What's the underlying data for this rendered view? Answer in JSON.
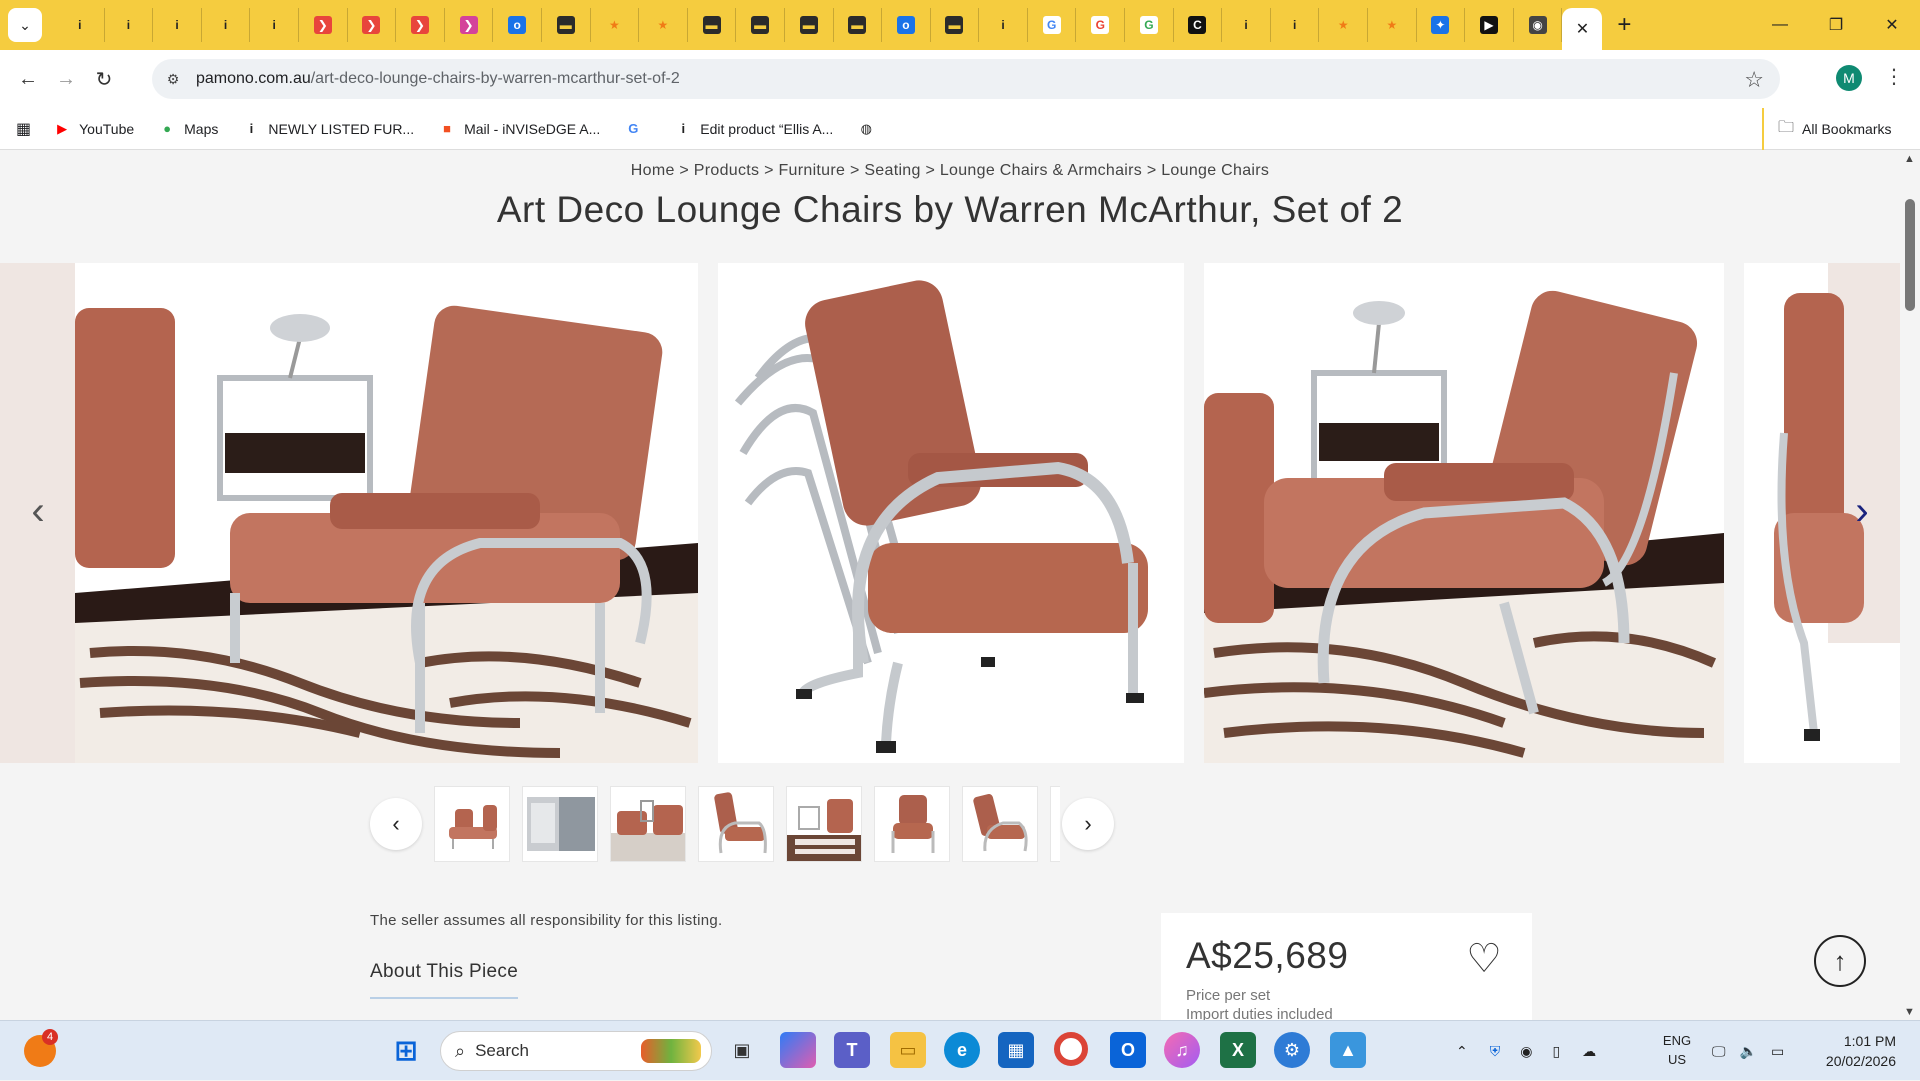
{
  "browser": {
    "active_tab_close": "✕",
    "new_tab": "+",
    "tab_favicons": [
      {
        "icon": "info-icon",
        "glyph": "i",
        "color": "#f5cc3f",
        "fg": "#222"
      },
      {
        "icon": "info-icon",
        "glyph": "i",
        "color": "#f5cc3f",
        "fg": "#222"
      },
      {
        "icon": "info-icon",
        "glyph": "i",
        "color": "#f5cc3f",
        "fg": "#222"
      },
      {
        "icon": "info-icon",
        "glyph": "i",
        "color": "#f5cc3f",
        "fg": "#222"
      },
      {
        "icon": "info-icon",
        "glyph": "i",
        "color": "#f5cc3f",
        "fg": "#222"
      },
      {
        "icon": "bird-icon",
        "glyph": "❯",
        "color": "#e8453c",
        "fg": "#fff"
      },
      {
        "icon": "bird-icon",
        "glyph": "❯",
        "color": "#e8453c",
        "fg": "#fff"
      },
      {
        "icon": "bird-icon",
        "glyph": "❯",
        "color": "#e8453c",
        "fg": "#fff"
      },
      {
        "icon": "bird-icon",
        "glyph": "❯",
        "color": "#d4429b",
        "fg": "#fff"
      },
      {
        "icon": "outlook-icon",
        "glyph": "o",
        "color": "#1a73e8",
        "fg": "#fff"
      },
      {
        "icon": "briefcase-icon",
        "glyph": "▬",
        "color": "#2b2b2b",
        "fg": "#f5cc3f"
      },
      {
        "icon": "star-icon",
        "glyph": "★",
        "color": "#f5cc3f",
        "fg": "#f07b16"
      },
      {
        "icon": "star-icon",
        "glyph": "★",
        "color": "#f5cc3f",
        "fg": "#f07b16"
      },
      {
        "icon": "briefcase-icon",
        "glyph": "▬",
        "color": "#2b2b2b",
        "fg": "#f5cc3f"
      },
      {
        "icon": "briefcase-icon",
        "glyph": "▬",
        "color": "#2b2b2b",
        "fg": "#f5cc3f"
      },
      {
        "icon": "briefcase-icon",
        "glyph": "▬",
        "color": "#2b2b2b",
        "fg": "#f5cc3f"
      },
      {
        "icon": "briefcase-icon",
        "glyph": "▬",
        "color": "#2b2b2b",
        "fg": "#f5cc3f"
      },
      {
        "icon": "outlook-icon",
        "glyph": "o",
        "color": "#1a73e8",
        "fg": "#fff"
      },
      {
        "icon": "briefcase-icon",
        "glyph": "▬",
        "color": "#2b2b2b",
        "fg": "#f5cc3f"
      },
      {
        "icon": "info-icon",
        "glyph": "i",
        "color": "#f5cc3f",
        "fg": "#222"
      },
      {
        "icon": "google-icon",
        "glyph": "G",
        "color": "#fff",
        "fg": "#4285f4"
      },
      {
        "icon": "google-icon",
        "glyph": "G",
        "color": "#fff",
        "fg": "#ea4335"
      },
      {
        "icon": "google-icon",
        "glyph": "G",
        "color": "#fff",
        "fg": "#34a853"
      },
      {
        "icon": "c-logo-icon",
        "glyph": "C",
        "color": "#111",
        "fg": "#fff"
      },
      {
        "icon": "info-icon",
        "glyph": "i",
        "color": "#f5cc3f",
        "fg": "#222"
      },
      {
        "icon": "info-icon",
        "glyph": "i",
        "color": "#f5cc3f",
        "fg": "#222"
      },
      {
        "icon": "star-icon",
        "glyph": "★",
        "color": "#f5cc3f",
        "fg": "#f07b16"
      },
      {
        "icon": "star-icon",
        "glyph": "★",
        "color": "#f5cc3f",
        "fg": "#f07b16"
      },
      {
        "icon": "people-icon",
        "glyph": "✦",
        "color": "#1a73e8",
        "fg": "#fff"
      },
      {
        "icon": "play-icon",
        "glyph": "▶",
        "color": "#111",
        "fg": "#fff"
      },
      {
        "icon": "chrome-icon",
        "glyph": "◉",
        "color": "#444",
        "fg": "#fff"
      }
    ],
    "url_domain": "pamono.com.au",
    "url_path": "/art-deco-lounge-chairs-by-warren-mcarthur-set-of-2",
    "profile_initial": "M",
    "bookmarks": [
      {
        "label": "YouTube",
        "icon": "youtube-icon",
        "glyph": "▶",
        "color": "#ff0000"
      },
      {
        "label": "Maps",
        "icon": "maps-icon",
        "glyph": "●",
        "color": "#34a853"
      },
      {
        "label": "NEWLY LISTED FUR...",
        "icon": "info-icon",
        "glyph": "i",
        "color": "#222"
      },
      {
        "label": "Mail - iNVISeDGE A...",
        "icon": "microsoft-icon",
        "glyph": "■",
        "color": "#f25022"
      },
      {
        "label": "",
        "icon": "google-icon",
        "glyph": "G",
        "color": "#4285f4"
      },
      {
        "label": "Edit product “Ellis A...",
        "icon": "info-icon",
        "glyph": "i",
        "color": "#222"
      },
      {
        "label": "",
        "icon": "globe-icon",
        "glyph": "◍",
        "color": "#222"
      }
    ],
    "all_bookmarks": "All Bookmarks"
  },
  "page": {
    "breadcrumb": "Home > Products > Furniture > Seating > Lounge Chairs & Armchairs > Lounge Chairs",
    "title": "Art Deco Lounge Chairs by Warren McArthur, Set of 2",
    "seller_note": "The seller assumes all responsibility for this listing.",
    "about_heading": "About This Piece",
    "price": "A$25,689",
    "price_unit": "Price per set",
    "duties": "Import duties included",
    "thumbnail_count": 8
  },
  "taskbar": {
    "search_placeholder": "Search",
    "notification_count": "4",
    "lang_line1": "ENG",
    "lang_line2": "US",
    "time": "1:01 PM",
    "date": "20/02/2026"
  },
  "colors": {
    "tab_strip": "#f5cc3f",
    "leather": "#b4644f",
    "chrome": "#b7bbc0",
    "page_bg": "#f4f4f4"
  }
}
